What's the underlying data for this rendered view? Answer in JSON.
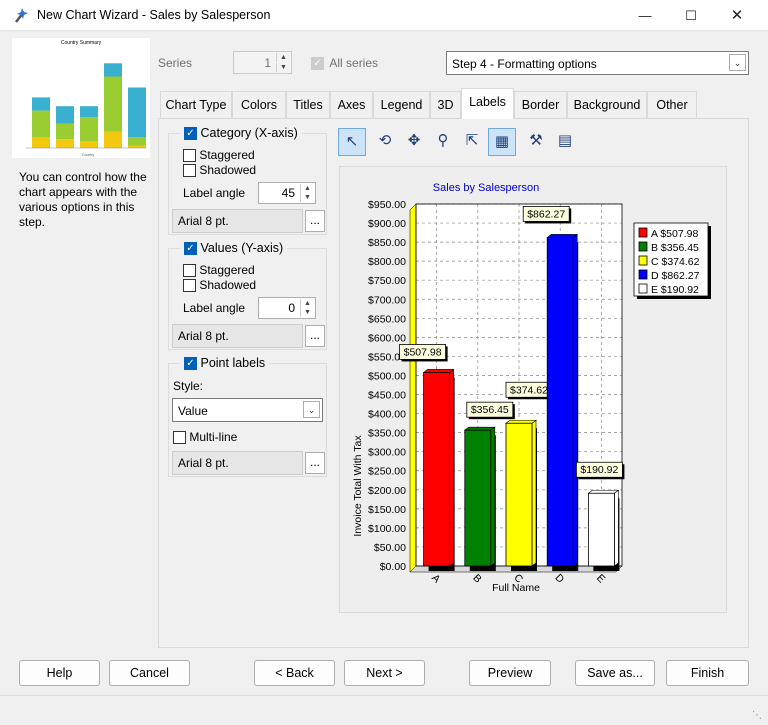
{
  "window": {
    "title": "New Chart Wizard - Sales by Salesperson"
  },
  "thumbnail": {
    "title": "Country Summary",
    "xlabel": "Country",
    "values": [
      [
        10,
        24,
        12
      ],
      [
        8,
        14,
        16
      ],
      [
        6,
        22,
        10
      ],
      [
        15,
        50,
        12
      ],
      [
        2,
        8,
        45
      ]
    ]
  },
  "description": "You can control how the chart appears with the various options in this step.",
  "series": {
    "label": "Series",
    "value": "1",
    "all_label": "All series"
  },
  "step": {
    "value": "Step 4 - Formatting options"
  },
  "tabs": [
    "Chart Type",
    "Colors",
    "Titles",
    "Axes",
    "Legend",
    "3D",
    "Labels",
    "Border",
    "Background",
    "Other"
  ],
  "category": {
    "title": "Category (X-axis)",
    "staggered": "Staggered",
    "shadowed": "Shadowed",
    "angle_label": "Label angle",
    "angle_value": "45",
    "font": "Arial 8 pt.",
    "dots": "..."
  },
  "values_axis": {
    "title": "Values (Y-axis)",
    "staggered": "Staggered",
    "shadowed": "Shadowed",
    "angle_label": "Label angle",
    "angle_value": "0",
    "font": "Arial 8 pt.",
    "dots": "..."
  },
  "point_labels": {
    "title": "Point labels",
    "style_label": "Style:",
    "style_value": "Value",
    "multiline": "Multi-line",
    "font": "Arial 8 pt.",
    "dots": "..."
  },
  "toolbar": [
    "pointer-icon",
    "rotate-icon",
    "move-icon",
    "zoom-icon",
    "resize-icon",
    "3d-view-icon",
    "tools-icon",
    "chart-data-icon"
  ],
  "chart_data": {
    "type": "bar",
    "title": "Sales by Salesperson",
    "xlabel": "Full Name",
    "ylabel": "Invoice Total With Tax",
    "categories": [
      "A",
      "B",
      "C",
      "D",
      "E"
    ],
    "values": [
      507.98,
      356.45,
      374.62,
      862.27,
      190.92
    ],
    "point_labels": [
      "$507.98",
      "$356.45",
      "$374.62",
      "$862.27",
      "$190.92"
    ],
    "colors": [
      "#ff0000",
      "#008000",
      "#ffff00",
      "#0000ff",
      "#ffffff"
    ],
    "ylim": [
      0,
      950
    ],
    "yticks": [
      "$0.00",
      "$50.00",
      "$100.00",
      "$150.00",
      "$200.00",
      "$250.00",
      "$300.00",
      "$350.00",
      "$400.00",
      "$450.00",
      "$500.00",
      "$550.00",
      "$600.00",
      "$650.00",
      "$700.00",
      "$750.00",
      "$800.00",
      "$850.00",
      "$900.00",
      "$950.00"
    ],
    "legend": [
      "A $507.98",
      "B $356.45",
      "C $374.62",
      "D $862.27",
      "E $190.92"
    ],
    "legend_position": "top-right",
    "grid": true
  },
  "buttons": {
    "help": "Help",
    "cancel": "Cancel",
    "back": "< Back",
    "next": "Next >",
    "preview": "Preview",
    "save": "Save as...",
    "finish": "Finish"
  }
}
